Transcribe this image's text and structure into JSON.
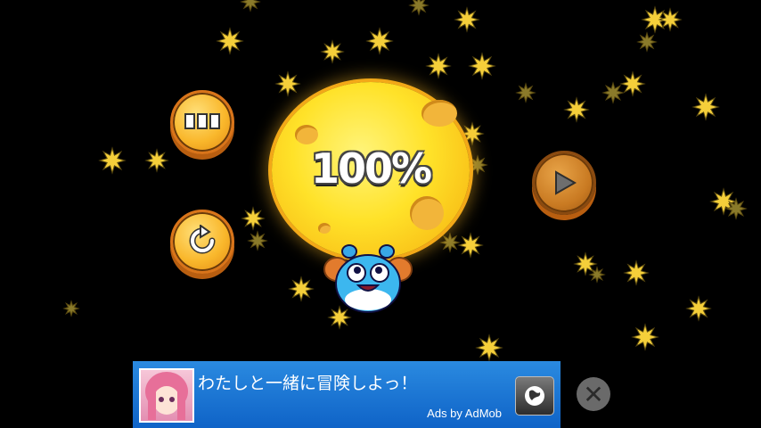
{
  "level_result": {
    "completion_percent": "100%"
  },
  "buttons": {
    "menu_icon": "level-menu-icon",
    "retry_icon": "retry-icon",
    "next_icon": "play-next-icon"
  },
  "ad": {
    "headline": "わたしと一緒に冒険しよっ！",
    "credit": "Ads by AdMob",
    "action_icon": "globe-icon",
    "close_icon": "close-icon"
  },
  "colors": {
    "background": "#000000",
    "moon": "#ffe229",
    "button_orange": "#f9b72b",
    "ad_blue": "#1570d6"
  }
}
